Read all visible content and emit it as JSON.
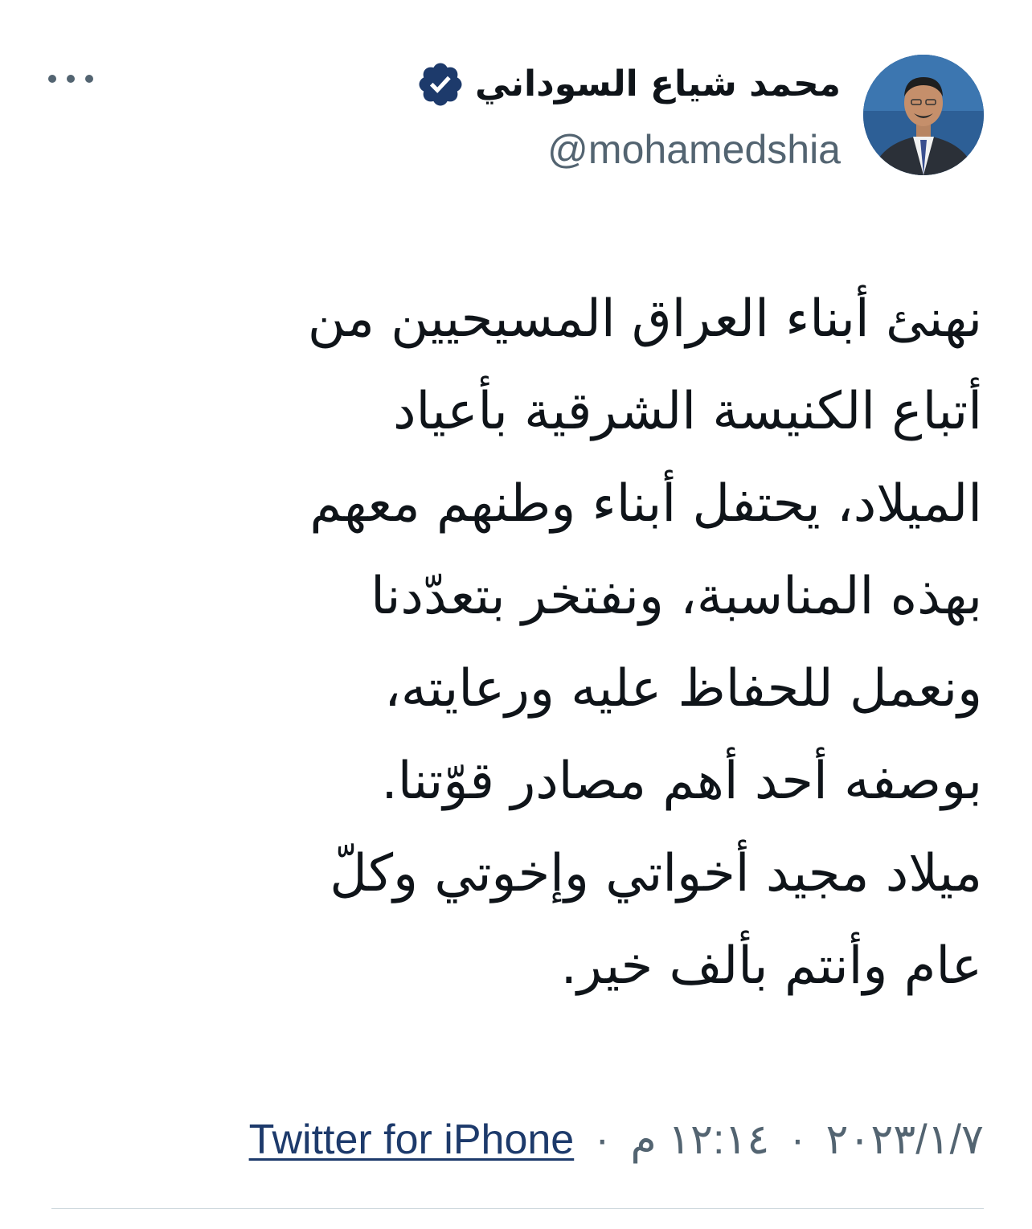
{
  "author": {
    "display_name": "محمد شياع السوداني",
    "handle": "@mohamedshia",
    "verified_icon": "verified-badge-icon",
    "avatar": "profile-photo"
  },
  "tweet": {
    "lines": [
      "نهنئ أبناء العراق المسيحيين من",
      "أتباع الكنيسة الشرقية بأعياد",
      "الميلاد، يحتفل أبناء وطنهم معهم",
      "بهذه المناسبة، ونفتخر بتعدّدنا",
      "ونعمل للحفاظ عليه ورعايته،",
      "بوصفه أحد أهم مصادر قوّتنا.",
      "ميلاد مجيد أخواتي وإخوتي وكلّ",
      "عام وأنتم بألف خير."
    ]
  },
  "meta": {
    "date": "٢٠٢٣/١/٧",
    "time": "١٢:١٤ م",
    "separator": "·",
    "source": "Twitter for iPhone"
  },
  "colors": {
    "text": "#0f1419",
    "secondary": "#536471",
    "link": "#1d3a6b",
    "divider": "#cfd9de",
    "verified_badge": "#1d3a6b"
  }
}
